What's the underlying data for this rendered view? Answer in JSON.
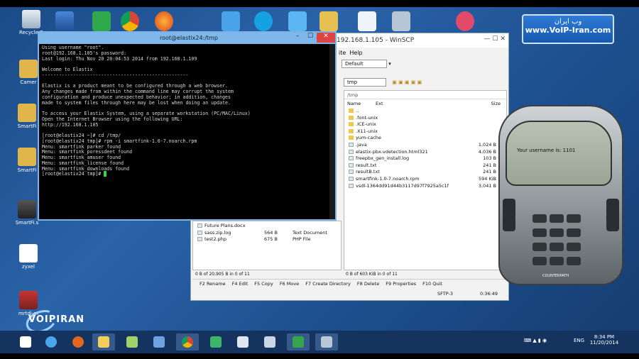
{
  "brand": {
    "persian": "وب ایران",
    "url": "www.VoIP-Iran.com",
    "watermark": "VOIPIRAN"
  },
  "desktop_icons": [
    {
      "label": "Recycle B",
      "icon": "recycle-bin-icon"
    },
    {
      "label": "Camer",
      "icon": "folder-icon"
    },
    {
      "label": "SmartFi",
      "icon": "folder-icon"
    },
    {
      "label": "SmartFi",
      "icon": "folder-icon"
    },
    {
      "label": "SmartFi.s",
      "icon": "app-icon"
    },
    {
      "label": "zyxel",
      "icon": "network-icon"
    },
    {
      "label": "mrtdi-m",
      "icon": "app-icon"
    }
  ],
  "top_icons": [
    "monitor-icon",
    "green-app-icon",
    "chrome-icon",
    "firefox-icon",
    "network-icon",
    "skype-icon",
    "ie-icon",
    "app-icon",
    "curve-icon",
    "app-icon",
    "itunes-icon"
  ],
  "terminal": {
    "title": "root@elastix24:/tmp",
    "lines": [
      "Using username \"root\".",
      "root@192.168.1.105's password:",
      "Last login: Thu Nov 20 20:04:53 2014 from 192.168.1.109",
      "",
      "Welcome to Elastix",
      "----------------------------------------------------",
      "",
      "Elastix is a product meant to be configured through a web browser.",
      "Any changes made from within the command line may corrupt the system",
      "configuration and produce unexpected behavior; in addition, changes",
      "made to system files through here may be lost when doing an update.",
      "",
      "To access your Elastix System, using a separate workstation (PC/MAC/Linux)",
      "Open the Internet Browser using the following URL:",
      "http://192.168.1.105",
      "",
      "[root@elastix24 ~]# cd /tmp/",
      "[root@elastix24 tmp]# rpm -i smartfink-1.0-7.noarch.rpm",
      "Menu: smartfink parker found",
      "Menu: smartfink_poressdeet found",
      "Menu: smartfink_amuser found",
      "Menu: smartfink_license found",
      "Menu: smartfink_downloads found",
      "[root@elastix24 tmp]# "
    ]
  },
  "winscp": {
    "title": "192.168.1.105 - WinSCP",
    "menu": [
      "ite",
      "Help"
    ],
    "session_select": "Default",
    "remote_dir": "tmp",
    "remote_path": "/tmp",
    "columns": {
      "name": "Name",
      "ext": "Ext",
      "size": "Size"
    },
    "remote_files": [
      {
        "name": "..",
        "size": "",
        "kind": "up"
      },
      {
        "name": ".font-unix",
        "size": "",
        "kind": "folder"
      },
      {
        "name": ".ICE-unix",
        "size": "",
        "kind": "folder"
      },
      {
        "name": ".X11-unix",
        "size": "",
        "kind": "folder"
      },
      {
        "name": "yum-cache",
        "size": "",
        "kind": "folder"
      },
      {
        "name": ".java",
        "size": "1,024 B",
        "kind": "file"
      },
      {
        "name": "elastix-pbx-vdetection.html321",
        "size": "4,036 B",
        "kind": "file"
      },
      {
        "name": "freepbx_gen_install.log",
        "size": "103 B",
        "kind": "file"
      },
      {
        "name": "result.txt",
        "size": "241 B",
        "kind": "file"
      },
      {
        "name": "resultB.txt",
        "size": "241 B",
        "kind": "file"
      },
      {
        "name": "smartfink-1.0-7.noarch.rpm",
        "size": "594 KiB",
        "kind": "file"
      },
      {
        "name": "vsdl-1364dd91d44b3117d97f7925a5c1f",
        "size": "3,041 B",
        "kind": "file"
      }
    ],
    "local_files": [
      {
        "name": "Future Plans.docx",
        "size": "",
        "type": ""
      },
      {
        "name": "sass.zip.log",
        "size": "564 B",
        "type": "Text Document"
      },
      {
        "name": "test2.php",
        "size": "675 B",
        "type": "PHP File"
      }
    ],
    "status_left": "0 B of 20,905 B in 0 of 11",
    "status_right": "0 B of 603 KiB in 0 of 11",
    "commands": [
      "F2 Rename",
      "F4 Edit",
      "F5 Copy",
      "F6 Move",
      "F7 Create Directory",
      "F8 Delete",
      "F9 Properties",
      "F10 Quit"
    ],
    "protocol": "SFTP-3",
    "elapsed": "0:36:49"
  },
  "phone": {
    "screen_text": "Your username is: 1101",
    "brand": "COUNTERPATH"
  },
  "taskbar": {
    "apps": [
      "ie-icon",
      "firefox-icon",
      "explorer-icon",
      "notepad-icon",
      "monitor-icon",
      "chrome-icon",
      "recycle-icon",
      "zyxel-icon",
      "elastix-icon",
      "putty-icon"
    ],
    "lang": "ENG",
    "time": "8:34 PM",
    "date": "11/20/2014"
  }
}
